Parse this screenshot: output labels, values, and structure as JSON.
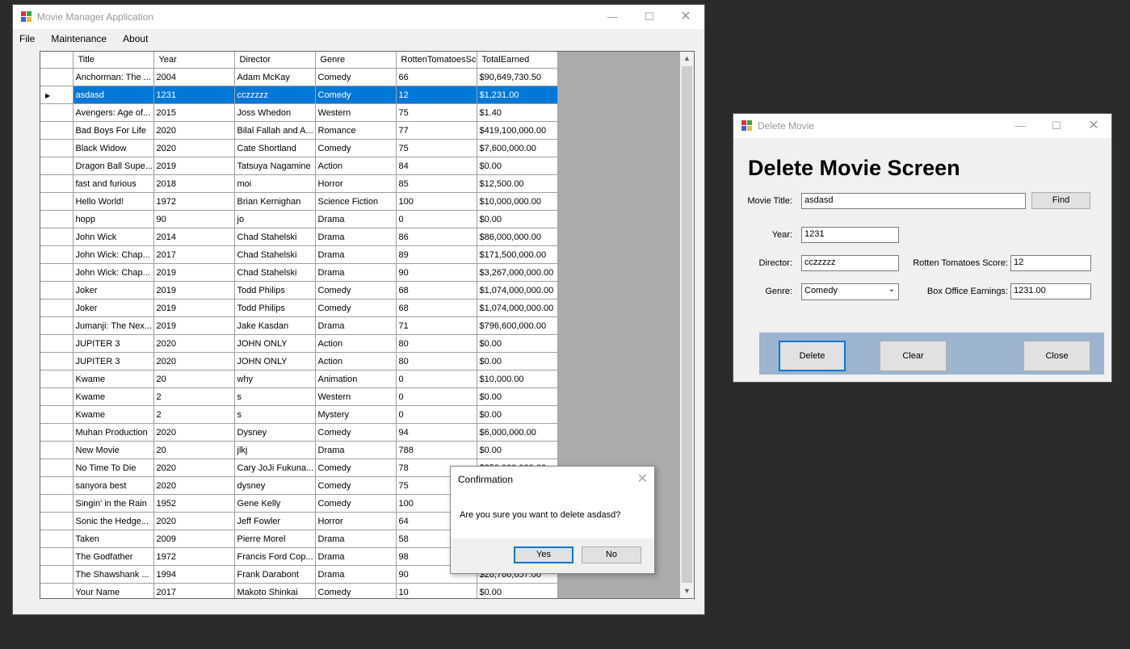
{
  "main_window": {
    "title": "Movie Manager Application",
    "menu": [
      "File",
      "Maintenance",
      "About"
    ],
    "columns": [
      "Title",
      "Year",
      "Director",
      "Genre",
      "RottenTomatoesSc",
      "TotalEarned"
    ],
    "selected_row": 1,
    "rows": [
      [
        "Anchorman: The ...",
        "2004",
        "Adam McKay",
        "Comedy",
        "66",
        "$90,649,730.50"
      ],
      [
        "asdasd",
        "1231",
        "cczzzzz",
        "Comedy",
        "12",
        "$1,231.00"
      ],
      [
        "Avengers: Age of...",
        "2015",
        "Joss Whedon",
        "Western",
        "75",
        "$1.40"
      ],
      [
        "Bad Boys For Life",
        "2020",
        "Bilal Fallah and A...",
        "Romance",
        "77",
        "$419,100,000.00"
      ],
      [
        "Black Widow",
        "2020",
        "Cate Shortland",
        "Comedy",
        "75",
        "$7,600,000.00"
      ],
      [
        "Dragon Ball Supe...",
        "2019",
        "Tatsuya Nagamine",
        "Action",
        "84",
        "$0.00"
      ],
      [
        "fast and furious",
        "2018",
        "moi",
        "Horror",
        "85",
        "$12,500.00"
      ],
      [
        "Hello World!",
        "1972",
        "Brian Kernighan",
        "Science Fiction",
        "100",
        "$10,000,000.00"
      ],
      [
        "hopp",
        "90",
        "jo",
        "Drama",
        "0",
        "$0.00"
      ],
      [
        "John Wick",
        "2014",
        "Chad Stahelski",
        "Drama",
        "86",
        "$86,000,000.00"
      ],
      [
        "John Wick: Chap...",
        "2017",
        "Chad Stahelski",
        "Drama",
        "89",
        "$171,500,000.00"
      ],
      [
        "John Wick: Chap...",
        "2019",
        "Chad Stahelski",
        "Drama",
        "90",
        "$3,267,000,000.00"
      ],
      [
        "Joker",
        "2019",
        "Todd Philips",
        "Comedy",
        "68",
        "$1,074,000,000.00"
      ],
      [
        "Joker",
        "2019",
        "Todd Philips",
        "Comedy",
        "68",
        "$1,074,000,000.00"
      ],
      [
        "Jumanji: The Nex...",
        "2019",
        "Jake Kasdan",
        "Drama",
        "71",
        "$796,600,000.00"
      ],
      [
        "JUPITER 3",
        "2020",
        "JOHN ONLY",
        "Action",
        "80",
        "$0.00"
      ],
      [
        "JUPITER 3",
        "2020",
        "JOHN ONLY",
        "Action",
        "80",
        "$0.00"
      ],
      [
        "Kwame",
        "20",
        "why",
        "Animation",
        "0",
        "$10,000.00"
      ],
      [
        "Kwame",
        "2",
        "s",
        "Western",
        "0",
        "$0.00"
      ],
      [
        "Kwame",
        "2",
        "s",
        "Mystery",
        "0",
        "$0.00"
      ],
      [
        "Muhan Production",
        "2020",
        "Dysney",
        "Comedy",
        "94",
        "$6,000,000.00"
      ],
      [
        "New Movie",
        "20",
        "jlkj",
        "Drama",
        "788",
        "$0.00"
      ],
      [
        "No Time To Die",
        "2020",
        "Cary JoJi Fukuna...",
        "Comedy",
        "78",
        "$250,000,000.00"
      ],
      [
        "sanyora best",
        "2020",
        "dysney",
        "Comedy",
        "75",
        ""
      ],
      [
        "Singin' in the Rain",
        "1952",
        "Gene Kelly",
        "Comedy",
        "100",
        ""
      ],
      [
        "Sonic the Hedge...",
        "2020",
        "Jeff Fowler",
        "Horror",
        "64",
        ""
      ],
      [
        "Taken",
        "2009",
        "Pierre Morel",
        "Drama",
        "58",
        ""
      ],
      [
        "The Godfather",
        "1972",
        "Francis Ford Cop...",
        "Drama",
        "98",
        ""
      ],
      [
        "The Shawshank ...",
        "1994",
        "Frank Darabont",
        "Drama",
        "90",
        "$28,786,657.00"
      ],
      [
        "Your Name",
        "2017",
        "Makoto Shinkai",
        "Comedy",
        "10",
        "$0.00"
      ]
    ]
  },
  "confirm_dialog": {
    "title": "Confirmation",
    "message": "Are you sure you want to delete asdasd?",
    "yes_label": "Yes",
    "no_label": "No"
  },
  "delete_window": {
    "title": "Delete Movie",
    "heading": "Delete Movie Screen",
    "movie_title_label": "Movie Title:",
    "movie_title_value": "asdasd",
    "find_label": "Find",
    "year_label": "Year:",
    "year_value": "1231",
    "director_label": "Director:",
    "director_value": "cczzzzz",
    "genre_label": "Genre:",
    "genre_value": "Comedy",
    "rt_label": "Rotten Tomatoes Score:",
    "rt_value": "12",
    "box_label": "Box Office Earnings:",
    "box_value": "1231.00",
    "delete_label": "Delete",
    "clear_label": "Clear",
    "close_label": "Close"
  },
  "colors": {
    "selection": "#0078d7",
    "footer_panel": "#9db4d1"
  }
}
